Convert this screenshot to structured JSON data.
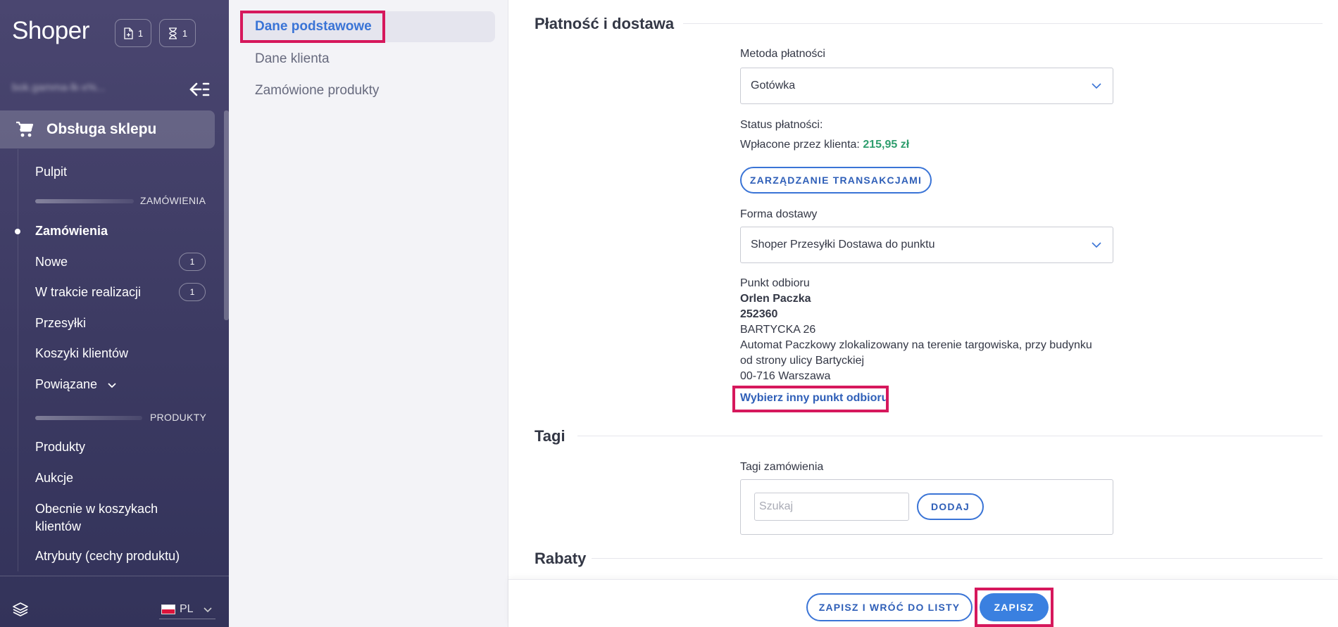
{
  "sidebar": {
    "logo": "Shoper",
    "badges": [
      {
        "icon": "file-plus-icon",
        "count": "1"
      },
      {
        "icon": "hourglass-icon",
        "count": "1"
      }
    ],
    "store_name": "bok.gamma-lk-x%...",
    "section": {
      "icon": "cart-icon",
      "label": "Obsługa sklepu"
    },
    "items": [
      {
        "label": "Pulpit"
      },
      {
        "label": "Zamówienia",
        "active": true
      },
      {
        "label": "Nowe",
        "count": "1"
      },
      {
        "label": "W trakcie realizacji",
        "count": "1"
      },
      {
        "label": "Przesyłki"
      },
      {
        "label": "Koszyki klientów"
      },
      {
        "label": "Powiązane"
      },
      {
        "label": "Produkty"
      },
      {
        "label": "Aukcje"
      },
      {
        "label": "Obecnie w koszykach klientów"
      },
      {
        "label": "Atrybuty (cechy produktu)"
      }
    ],
    "dividers": [
      "ZAMÓWIENIA",
      "PRODUKTY"
    ],
    "language": "PL"
  },
  "subnav": {
    "items": [
      "Dane podstawowe",
      "Dane klienta",
      "Zamówione produkty"
    ]
  },
  "payment": {
    "title": "Płatność i dostawa",
    "method_label": "Metoda płatności",
    "method_value": "Gotówka",
    "status_label": "Status płatności:",
    "paid_label": "Wpłacone przez klienta:",
    "paid_amount": "215,95 zł",
    "transactions_button": "ZARZĄDZANIE TRANSAKCJAMI",
    "delivery_label": "Forma dostawy",
    "delivery_value": "Shoper Przesyłki Dostawa do punktu",
    "pickup": {
      "label": "Punkt odbioru",
      "name": "Orlen Paczka",
      "code": "252360",
      "street": "BARTYCKA 26",
      "desc_line1": "Automat Paczkowy zlokalizowany na terenie targowiska, przy budynku",
      "desc_line2": "od strony ulicy Bartyckiej",
      "city": "00-716 Warszawa",
      "change_link": "Wybierz inny punkt odbioru"
    }
  },
  "tags": {
    "title": "Tagi",
    "field_label": "Tagi zamówienia",
    "placeholder": "Szukaj",
    "add_button": "DODAJ"
  },
  "discounts": {
    "title": "Rabaty"
  },
  "footer": {
    "save_return": "ZAPISZ I WRÓĆ DO LISTY",
    "save": "ZAPISZ"
  },
  "colors": {
    "accent": "#3a80e0",
    "highlight": "#d6185c",
    "sidebar": "#3c3a62",
    "amount": "#2f9e6e"
  }
}
